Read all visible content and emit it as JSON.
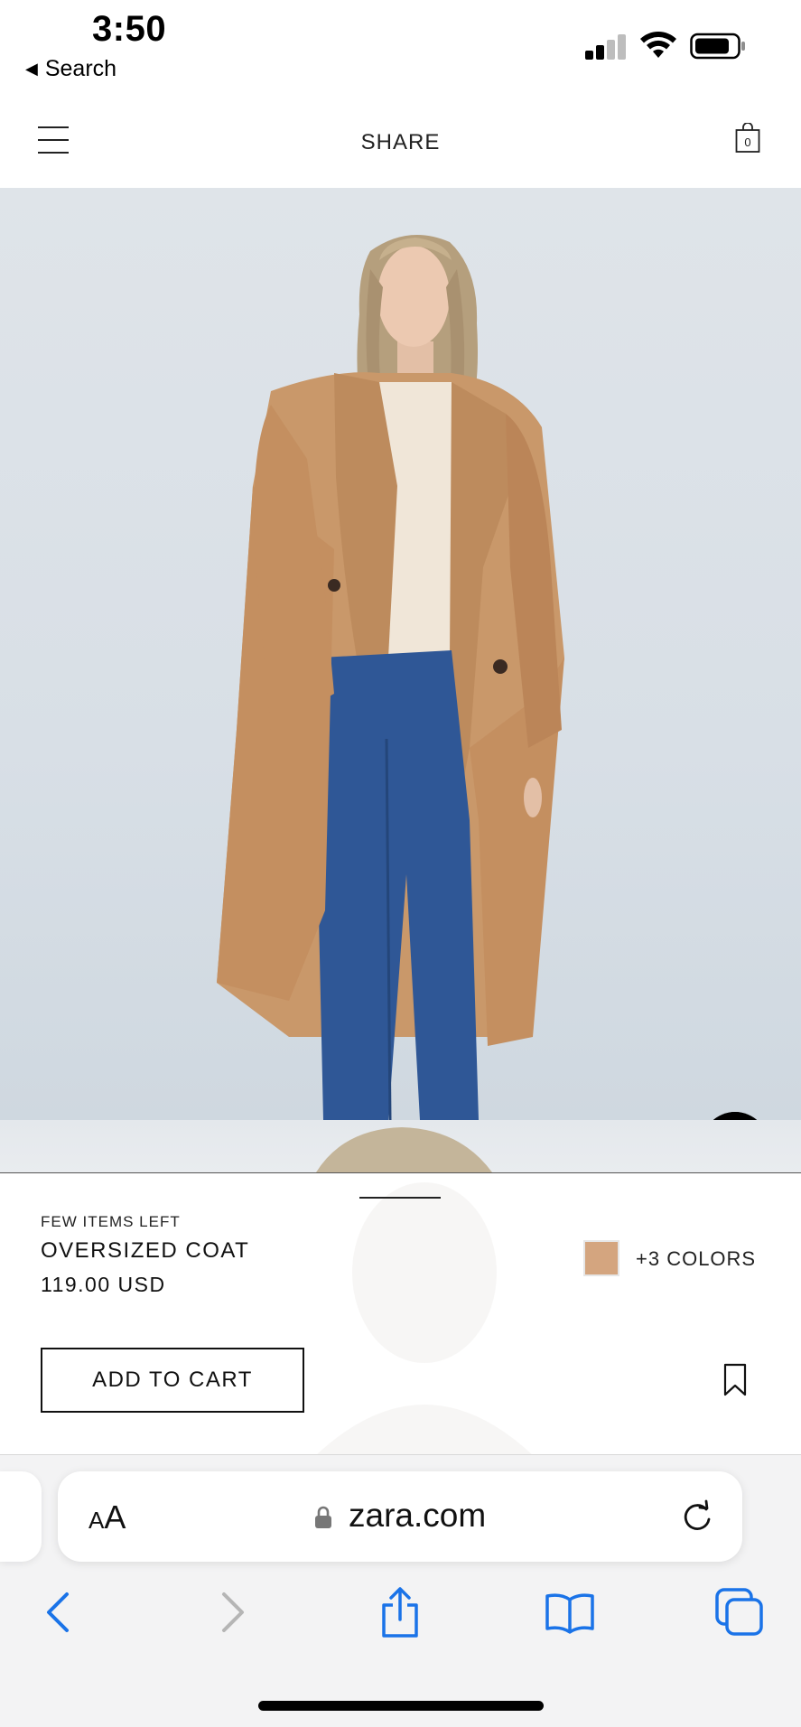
{
  "status_bar": {
    "time": "3:50",
    "back_label": "Search"
  },
  "site_header": {
    "title": "SHARE",
    "cart_count": "0"
  },
  "product": {
    "stock_note": "FEW ITEMS LEFT",
    "name": "OVERSIZED COAT",
    "price": "119.00 USD",
    "swatch_color": "#d4a57f",
    "colors_label": "+3 COLORS",
    "add_to_cart_label": "ADD TO CART"
  },
  "safari": {
    "text_size_label_small": "A",
    "text_size_label_large": "A",
    "url": "zara.com"
  },
  "colors": {
    "accent_blue": "#1a73e8",
    "coat": "#c9986a",
    "denim": "#2f5796"
  },
  "icons": {
    "menu": "hamburger-icon",
    "bag": "shopping-bag-icon",
    "accessibility": "accessibility-icon",
    "bookmark": "bookmark-icon",
    "lock": "lock-icon",
    "reload": "reload-icon",
    "back": "chevron-left-icon",
    "forward": "chevron-right-icon",
    "share": "share-icon",
    "bookmarks": "book-icon",
    "tabs": "tabs-icon"
  }
}
